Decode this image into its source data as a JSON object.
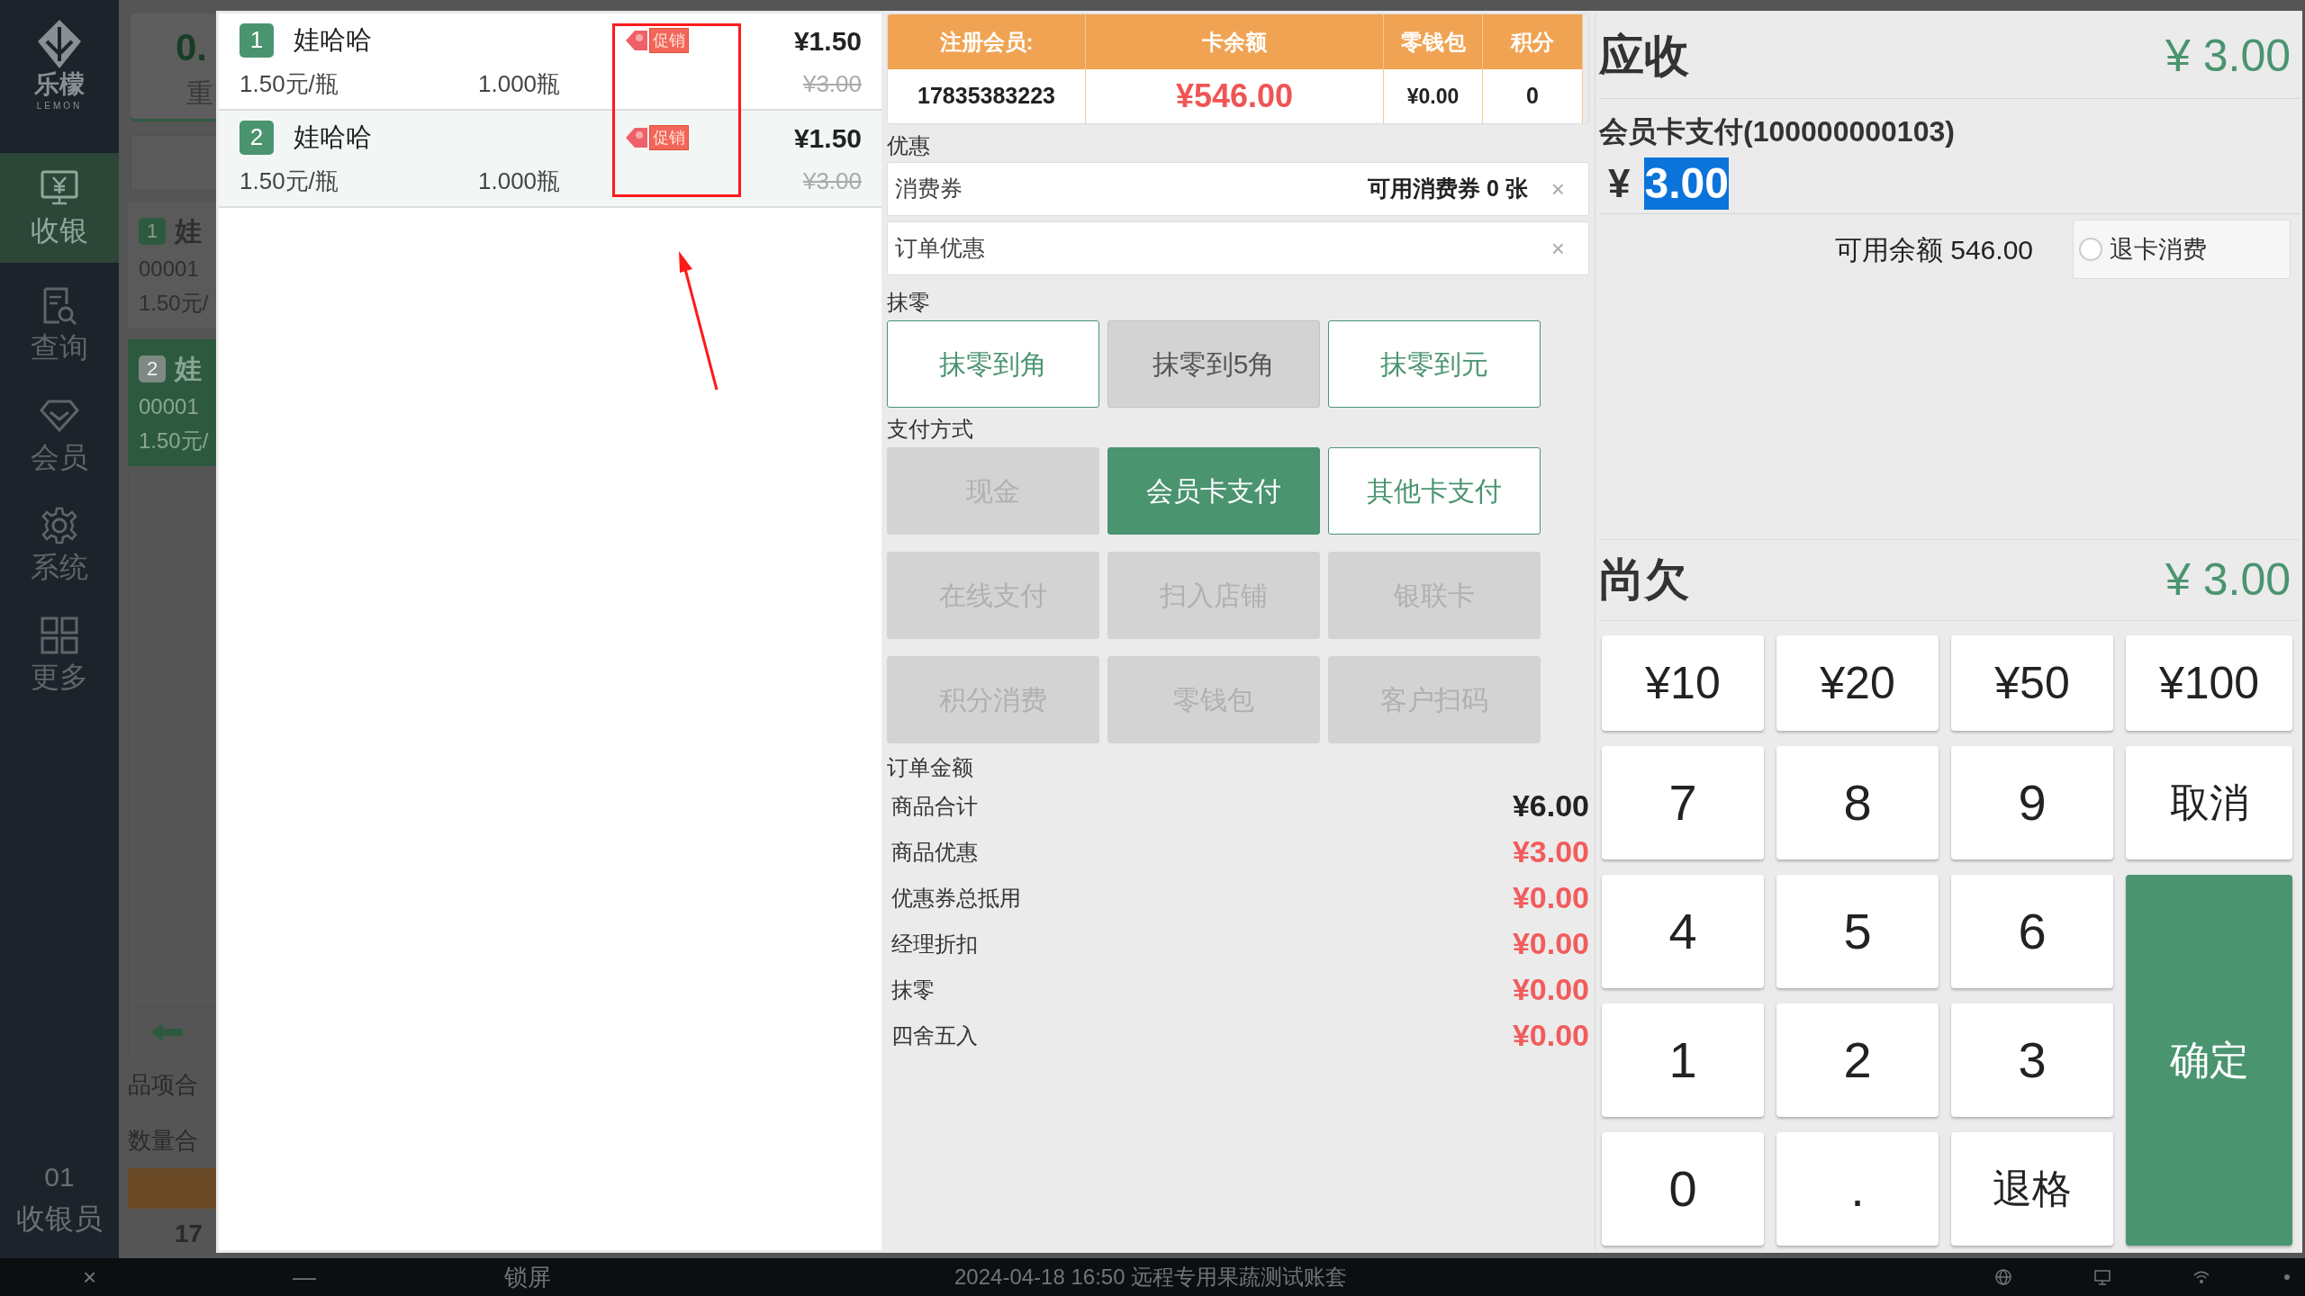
{
  "sidebar": {
    "logo_text": "乐檬",
    "logo_subtext": "LEMON",
    "items": [
      {
        "label": "收银",
        "selected": true
      },
      {
        "label": "查询",
        "selected": false
      },
      {
        "label": "会员",
        "selected": false
      },
      {
        "label": "系统",
        "selected": false
      },
      {
        "label": "更多",
        "selected": false
      }
    ],
    "user": {
      "id": "01",
      "role": "收银员"
    }
  },
  "background_screen": {
    "summary_value": "0.",
    "summary_label": "重",
    "items": [
      {
        "index": "1",
        "name": "娃",
        "code": "00001",
        "price": "1.50元/",
        "selected": false
      },
      {
        "index": "2",
        "name": "娃",
        "code": "00001",
        "price": "1.50元/",
        "selected": true
      }
    ],
    "totals": [
      "品项合",
      "数量合"
    ],
    "footer_value": "17"
  },
  "order_items": [
    {
      "index": "1",
      "name": "娃哈哈",
      "unit_price": "1.50元/瓶",
      "quantity": "1.000瓶",
      "badge": "促销",
      "price": "¥1.50",
      "original_price": "¥3.00",
      "selected": false
    },
    {
      "index": "2",
      "name": "娃哈哈",
      "unit_price": "1.50元/瓶",
      "quantity": "1.000瓶",
      "badge": "促销",
      "price": "¥1.50",
      "original_price": "¥3.00",
      "selected": true
    }
  ],
  "annotation": {
    "highlight_box": true,
    "arrow": true
  },
  "member": {
    "columns": [
      "注册会员:",
      "卡余额",
      "零钱包",
      "积分"
    ],
    "values": [
      "17835383223",
      "¥546.00",
      "¥0.00",
      "0"
    ]
  },
  "discounts": {
    "label": "优惠",
    "coupon": {
      "label": "消费券",
      "info": "可用消费券 0 张",
      "clear": "×"
    },
    "order_discount": {
      "label": "订单优惠",
      "clear": "×"
    }
  },
  "rounding": {
    "label": "抹零",
    "options": [
      {
        "label": "抹零到角",
        "disabled": false
      },
      {
        "label": "抹零到5角",
        "disabled": true
      },
      {
        "label": "抹零到元",
        "disabled": false
      }
    ]
  },
  "payment": {
    "label": "支付方式",
    "methods": [
      {
        "label": "现金",
        "selected": false,
        "disabled": true
      },
      {
        "label": "会员卡支付",
        "selected": true,
        "disabled": false
      },
      {
        "label": "其他卡支付",
        "selected": false,
        "disabled": false
      },
      {
        "label": "在线支付",
        "selected": false,
        "disabled": true
      },
      {
        "label": "扫入店铺",
        "selected": false,
        "disabled": true
      },
      {
        "label": "银联卡",
        "selected": false,
        "disabled": true
      },
      {
        "label": "积分消费",
        "selected": false,
        "disabled": true
      },
      {
        "label": "零钱包",
        "selected": false,
        "disabled": true
      },
      {
        "label": "客户扫码",
        "selected": false,
        "disabled": true
      }
    ]
  },
  "order_amount": {
    "label": "订单金额",
    "rows": [
      {
        "label": "商品合计",
        "value": "¥6.00",
        "kind": "total"
      },
      {
        "label": "商品优惠",
        "value": "¥3.00",
        "kind": "discount"
      },
      {
        "label": "优惠券总抵用",
        "value": "¥0.00",
        "kind": "discount"
      },
      {
        "label": "经理折扣",
        "value": "¥0.00",
        "kind": "discount"
      },
      {
        "label": "抹零",
        "value": "¥0.00",
        "kind": "discount"
      },
      {
        "label": "四舍五入",
        "value": "¥0.00",
        "kind": "discount"
      }
    ]
  },
  "receivable": {
    "label": "应收",
    "value": "¥ 3.00"
  },
  "payment_entry": {
    "label": "会员卡支付(100000000103)",
    "currency": "¥",
    "value": "3.00"
  },
  "available_balance": "可用余额 546.00",
  "refund_option": {
    "label": "退卡消费",
    "checked": false
  },
  "owed": {
    "label": "尚欠",
    "value": "¥ 3.00"
  },
  "keypad": [
    {
      "label": "¥10",
      "kind": "amount"
    },
    {
      "label": "¥20",
      "kind": "amount"
    },
    {
      "label": "¥50",
      "kind": "amount"
    },
    {
      "label": "¥100",
      "kind": "amount"
    },
    {
      "label": "7",
      "kind": "digit"
    },
    {
      "label": "8",
      "kind": "digit"
    },
    {
      "label": "9",
      "kind": "digit"
    },
    {
      "label": "取消",
      "kind": "action"
    },
    {
      "label": "4",
      "kind": "digit"
    },
    {
      "label": "5",
      "kind": "digit"
    },
    {
      "label": "6",
      "kind": "digit"
    },
    {
      "label": "1",
      "kind": "digit"
    },
    {
      "label": "2",
      "kind": "digit"
    },
    {
      "label": "3",
      "kind": "digit"
    },
    {
      "label": "0",
      "kind": "digit"
    },
    {
      "label": ".",
      "kind": "digit"
    },
    {
      "label": "退格",
      "kind": "action"
    },
    {
      "label": "确定",
      "kind": "confirm"
    }
  ],
  "status_bar": {
    "items": [
      {
        "label": "×",
        "kind": "close"
      },
      {
        "label": "—",
        "kind": "minimize"
      },
      {
        "label": "锁屏",
        "kind": "lock"
      }
    ],
    "info": "2024-04-18 16:50 远程专用果蔬测试账套"
  }
}
